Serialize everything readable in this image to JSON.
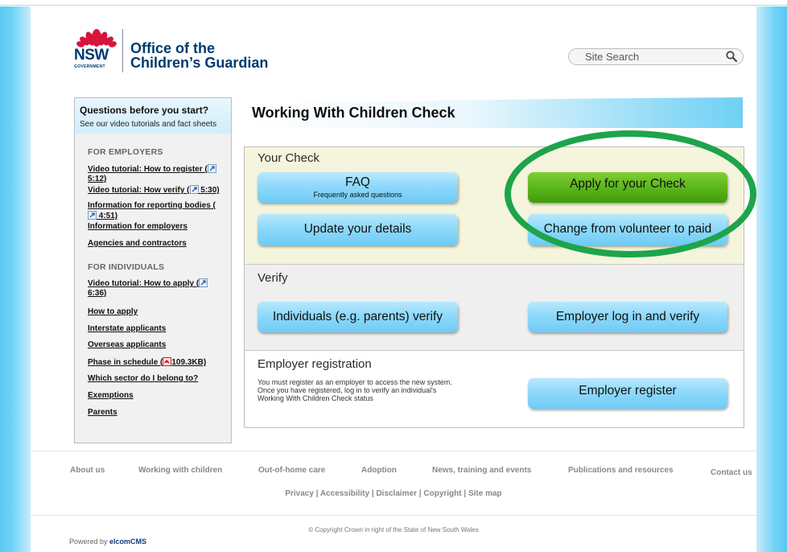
{
  "header": {
    "logo_nsw": "NSW",
    "logo_gov": "GOVERNMENT",
    "org_line1": "Office of the",
    "org_line2": "Children’s Guardian",
    "search_placeholder": "Site Search"
  },
  "sidebar": {
    "question": "Questions before you start?",
    "subtext": "See our video tutorials and fact sheets",
    "employers_heading": "FOR EMPLOYERS",
    "individuals_heading": "FOR INDIVIDUALS",
    "employer_links": [
      {
        "line1": "Video tutorial: How to register (",
        "line2": "5:12)"
      },
      {
        "line1": "Video tutorial: How verify (",
        "line2": "5:30)"
      },
      {
        "line1": "Information for reporting bodies (",
        "line2": "4:51)"
      },
      {
        "line1": "Information for employers"
      },
      {
        "line1": "Agencies and contractors"
      }
    ],
    "individual_links": [
      {
        "line1": "Video tutorial: How to apply (",
        "line2": "6:36)"
      },
      {
        "line1": "How to apply"
      },
      {
        "line1": "Interstate applicants"
      },
      {
        "line1": "Overseas applicants"
      },
      {
        "line1": "Phase in schedule  (",
        "line2": "109.3KB)"
      },
      {
        "line1": "Which sector do I belong to?"
      },
      {
        "line1": "Exemptions"
      },
      {
        "line1": "Parents"
      }
    ]
  },
  "main": {
    "title": "Working With Children Check",
    "your_check": {
      "heading": "Your Check",
      "faq_label": "FAQ",
      "faq_sub": "Frequently asked questions",
      "apply_label": "Apply for your Check",
      "update_label": "Update your details",
      "change_label": "Change from volunteer to paid"
    },
    "verify": {
      "heading": "Verify",
      "individuals_label": "Individuals (e.g. parents) verify",
      "employer_label": "Employer log in and verify"
    },
    "employer_registration": {
      "heading": "Employer registration",
      "text_line1": "You must register as an employer to access the new system.",
      "text_line2": "Once you have registered, log in to verify an individual's",
      "text_line3": "Working With Children Check status",
      "register_label": "Employer register"
    }
  },
  "footer": {
    "nav": [
      "About us",
      "Working with children",
      "Out-of-home care",
      "Adoption",
      "News, training and events",
      "Publications and resources",
      "Contact us"
    ],
    "legal": [
      "Privacy",
      "Accessibility",
      "Disclaimer",
      "Copyright",
      "Site map"
    ],
    "copyright": "© Copyright Crown in right of the State of New South Wales",
    "powered_prefix": "Powered by ",
    "powered_brand": "elcomCMS"
  },
  "colors": {
    "accent_blue": "#6fcbf4",
    "apply_green": "#5cb61b",
    "highlight_oval": "#1ea44b",
    "brand_navy": "#003a70"
  },
  "icons": [
    "waratah-logo",
    "search-icon",
    "video-icon",
    "pdf-icon"
  ]
}
